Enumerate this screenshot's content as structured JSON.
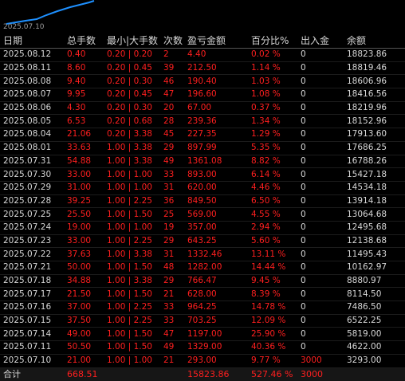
{
  "chart": {
    "date_label": "2025.07.10",
    "line_color": "#1e90ff"
  },
  "colors": {
    "negative_red": "#ff1f1f",
    "text": "#d8d8d8",
    "background": "#000000"
  },
  "table": {
    "headers": [
      "日期",
      "总手数",
      "最小|大手数",
      "次数",
      "盈亏金额",
      "百分比%",
      "出入金",
      "余额"
    ],
    "rows": [
      [
        "2025.08.12",
        "0.40",
        "0.20 | 0.20",
        "2",
        "4.40",
        "0.02 %",
        "0",
        "18823.86"
      ],
      [
        "2025.08.11",
        "8.60",
        "0.20 | 0.45",
        "39",
        "212.50",
        "1.14 %",
        "0",
        "18819.46"
      ],
      [
        "2025.08.08",
        "9.40",
        "0.20 | 0.30",
        "46",
        "190.40",
        "1.03 %",
        "0",
        "18606.96"
      ],
      [
        "2025.08.07",
        "9.95",
        "0.20 | 0.45",
        "47",
        "196.60",
        "1.08 %",
        "0",
        "18416.56"
      ],
      [
        "2025.08.06",
        "4.30",
        "0.20 | 0.30",
        "20",
        "67.00",
        "0.37 %",
        "0",
        "18219.96"
      ],
      [
        "2025.08.05",
        "6.53",
        "0.20 | 0.68",
        "28",
        "239.36",
        "1.34 %",
        "0",
        "18152.96"
      ],
      [
        "2025.08.04",
        "21.06",
        "0.20 | 3.38",
        "45",
        "227.35",
        "1.29 %",
        "0",
        "17913.60"
      ],
      [
        "2025.08.01",
        "33.63",
        "1.00 | 3.38",
        "29",
        "897.99",
        "5.35 %",
        "0",
        "17686.25"
      ],
      [
        "2025.07.31",
        "54.88",
        "1.00 | 3.38",
        "49",
        "1361.08",
        "8.82 %",
        "0",
        "16788.26"
      ],
      [
        "2025.07.30",
        "33.00",
        "1.00 | 1.00",
        "33",
        "893.00",
        "6.14 %",
        "0",
        "15427.18"
      ],
      [
        "2025.07.29",
        "31.00",
        "1.00 | 1.00",
        "31",
        "620.00",
        "4.46 %",
        "0",
        "14534.18"
      ],
      [
        "2025.07.28",
        "39.25",
        "1.00 | 2.25",
        "36",
        "849.50",
        "6.50 %",
        "0",
        "13914.18"
      ],
      [
        "2025.07.25",
        "25.50",
        "1.00 | 1.50",
        "25",
        "569.00",
        "4.55 %",
        "0",
        "13064.68"
      ],
      [
        "2025.07.24",
        "19.00",
        "1.00 | 1.00",
        "19",
        "357.00",
        "2.94 %",
        "0",
        "12495.68"
      ],
      [
        "2025.07.23",
        "33.00",
        "1.00 | 2.25",
        "29",
        "643.25",
        "5.60 %",
        "0",
        "12138.68"
      ],
      [
        "2025.07.22",
        "37.63",
        "1.00 | 3.38",
        "31",
        "1332.46",
        "13.11 %",
        "0",
        "11495.43"
      ],
      [
        "2025.07.21",
        "50.00",
        "1.00 | 1.50",
        "48",
        "1282.00",
        "14.44 %",
        "0",
        "10162.97"
      ],
      [
        "2025.07.18",
        "34.88",
        "1.00 | 3.38",
        "29",
        "766.47",
        "9.45 %",
        "0",
        "8880.97"
      ],
      [
        "2025.07.17",
        "21.50",
        "1.00 | 1.50",
        "21",
        "628.00",
        "8.39 %",
        "0",
        "8114.50"
      ],
      [
        "2025.07.16",
        "37.00",
        "1.00 | 2.25",
        "33",
        "964.25",
        "14.78 %",
        "0",
        "7486.50"
      ],
      [
        "2025.07.15",
        "37.50",
        "1.00 | 2.25",
        "33",
        "703.25",
        "12.09 %",
        "0",
        "6522.25"
      ],
      [
        "2025.07.14",
        "49.00",
        "1.00 | 1.50",
        "47",
        "1197.00",
        "25.90 %",
        "0",
        "5819.00"
      ],
      [
        "2025.07.11",
        "50.50",
        "1.00 | 1.50",
        "49",
        "1329.00",
        "40.36 %",
        "0",
        "4622.00"
      ],
      [
        "2025.07.10",
        "21.00",
        "1.00 | 1.00",
        "21",
        "293.00",
        "9.77 %",
        "3000",
        "3293.00"
      ]
    ],
    "total": {
      "label": "合计",
      "lots": "668.51",
      "profit": "15823.86",
      "percent": "527.46 %",
      "deposit": "3000"
    }
  }
}
